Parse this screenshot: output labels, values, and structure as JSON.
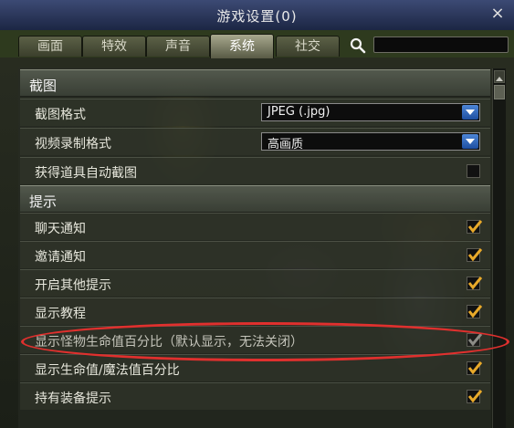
{
  "window": {
    "title": "游戏设置(0)",
    "close_glyph": "×"
  },
  "tabs": [
    {
      "label": "画面",
      "active": false
    },
    {
      "label": "特效",
      "active": false
    },
    {
      "label": "声音",
      "active": false
    },
    {
      "label": "系统",
      "active": true
    },
    {
      "label": "社交",
      "active": false
    }
  ],
  "search": {
    "value": "",
    "placeholder": ""
  },
  "screenshot_section": {
    "title": "截图",
    "format": {
      "label": "截图格式",
      "value": "JPEG (.jpg)"
    },
    "video_format": {
      "label": "视频录制格式",
      "value": "高画质"
    },
    "auto_capture": {
      "label": "获得道具自动截图",
      "checked": false
    }
  },
  "tips_section": {
    "title": "提示",
    "items": [
      {
        "label": "聊天通知",
        "checked": true
      },
      {
        "label": "邀请通知",
        "checked": true
      },
      {
        "label": "开启其他提示",
        "checked": true
      },
      {
        "label": "显示教程",
        "checked": true
      },
      {
        "label": "显示怪物生命值百分比（默认显示，无法关闭）",
        "checked": true,
        "disabled": true
      },
      {
        "label": "显示生命值/魔法值百分比",
        "checked": true
      },
      {
        "label": "持有装备提示",
        "checked": true
      }
    ]
  },
  "colors": {
    "accent": "#e8a92a",
    "highlight": "#e0302e",
    "titlebar": "#2c3860"
  }
}
